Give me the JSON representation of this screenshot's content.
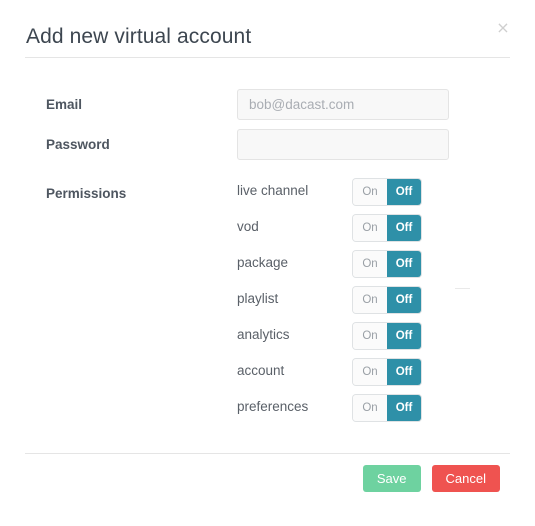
{
  "dialog": {
    "title": "Add new virtual account",
    "close_icon": "close-icon",
    "close_glyph": "×"
  },
  "form": {
    "email": {
      "label": "Email",
      "placeholder": "bob@dacast.com",
      "value": ""
    },
    "password": {
      "label": "Password",
      "placeholder": "",
      "value": ""
    },
    "permissions": {
      "label": "Permissions",
      "on_label": "On",
      "off_label": "Off",
      "items": [
        {
          "name": "live channel",
          "state": "Off"
        },
        {
          "name": "vod",
          "state": "Off"
        },
        {
          "name": "package",
          "state": "Off"
        },
        {
          "name": "playlist",
          "state": "Off"
        },
        {
          "name": "analytics",
          "state": "Off"
        },
        {
          "name": "account",
          "state": "Off"
        },
        {
          "name": "preferences",
          "state": "Off"
        }
      ]
    }
  },
  "footer": {
    "save_label": "Save",
    "cancel_label": "Cancel"
  },
  "colors": {
    "toggle_active": "#2e90a8",
    "toggle_inactive_bg": "#fbfbfb",
    "save_button": "#6ed2a0",
    "cancel_button": "#ef5350",
    "title_text": "#3d4650",
    "label_text": "#4e5660",
    "divider": "#e5e5e5",
    "input_bg": "#f8f8f8"
  }
}
